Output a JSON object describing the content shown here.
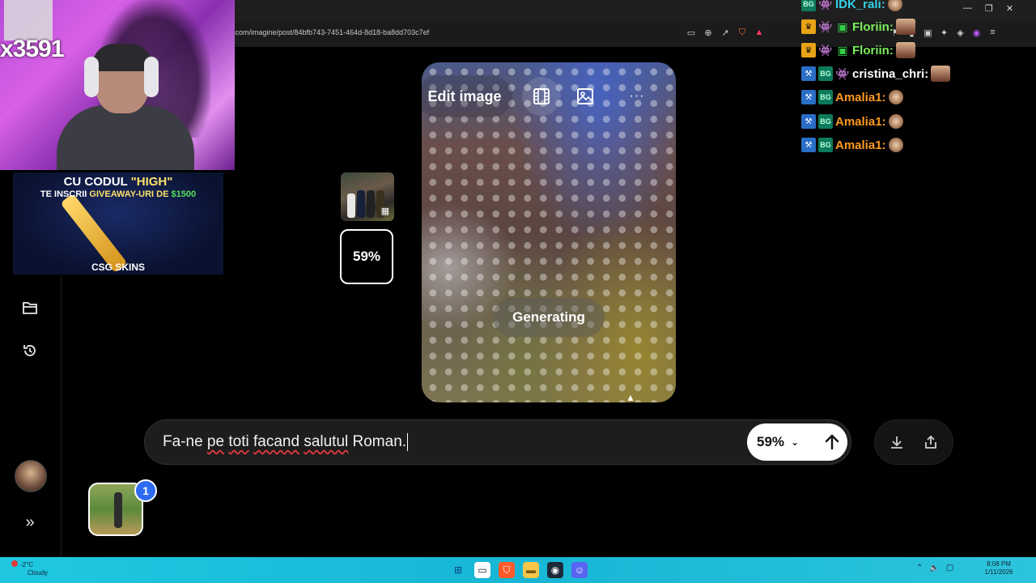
{
  "browser": {
    "url": ".com/imagine/post/84bfb743-7451-464d-8d18-ba8dd703c7ef"
  },
  "stream": {
    "counter": "x3591",
    "banner": {
      "line1_prefix": "CU CODUL ",
      "line1_highlight": "\"HIGH\"",
      "line2_prefix": "TE INSCRII ",
      "line2_mid": "GIVEAWAY-URI DE ",
      "line2_amount": "$1500",
      "brand": "CSG SKINS"
    }
  },
  "sidebar": {
    "items": [
      {
        "icon": "folder-icon"
      },
      {
        "icon": "history-icon"
      }
    ],
    "expand_icon": "double-chevron-right-icon"
  },
  "thumbnails": {
    "progress": "59%"
  },
  "card": {
    "edit_label": "Edit image",
    "status": "Generating",
    "more": "···"
  },
  "prompt": {
    "text_before": "Fa-ne ",
    "w1": "pe",
    "s1": " ",
    "w2": "toti",
    "s2": " ",
    "w3": "facand",
    "s3": " ",
    "w4": "salutul",
    "text_after": " Roman.",
    "mode": "59%"
  },
  "attachment": {
    "badge": "1"
  },
  "chat": {
    "messages": [
      {
        "user": "IDK_rali:",
        "color": "#35d0e6"
      },
      {
        "user": "Floriin:",
        "color": "#7cf05c"
      },
      {
        "user": "Floriin:",
        "color": "#7cf05c"
      },
      {
        "user": "cristina_chri:",
        "color": "#ffffff"
      },
      {
        "user": "Amalia1:",
        "color": "#ff9a1f"
      },
      {
        "user": "Amalia1:",
        "color": "#ff9a1f"
      },
      {
        "user": "Amalia1:",
        "color": "#ff9a1f"
      }
    ]
  },
  "taskbar": {
    "temp": "-2°C",
    "weather": "Cloudy",
    "time": "8:08 PM",
    "date": "1/11/2026"
  }
}
